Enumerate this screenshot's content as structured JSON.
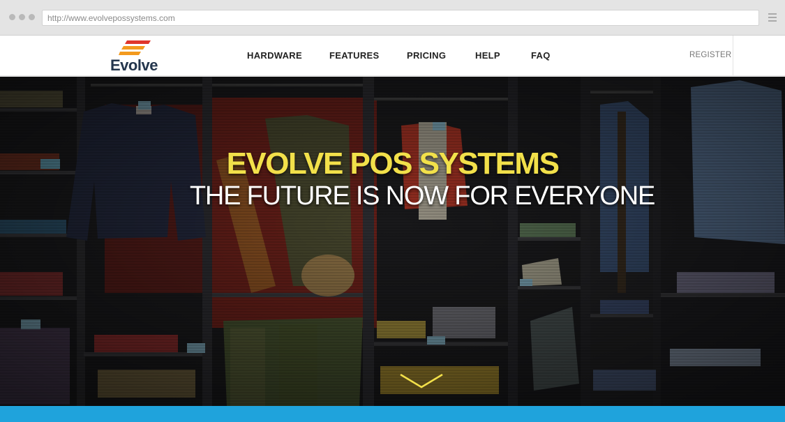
{
  "browser": {
    "url": "http://www.evolvepossystems.com"
  },
  "header": {
    "logo_text": "Evolve",
    "nav": [
      {
        "label": "HARDWARE"
      },
      {
        "label": "FEATURES"
      },
      {
        "label": "PRICING"
      },
      {
        "label": "HELP"
      },
      {
        "label": "FAQ"
      }
    ],
    "register_label": "REGISTER"
  },
  "hero": {
    "title": "EVOLVE POS SYSTEMS",
    "subtitle": "THE FUTURE IS NOW FOR EVERYONE",
    "scroll_icon": "chevron-down-icon"
  },
  "colors": {
    "accent_yellow": "#f2e04a",
    "logo_orange": "#f39a1e",
    "logo_red": "#e0362c",
    "strip_blue": "#1fa3dc",
    "logo_navy": "#24364d"
  }
}
